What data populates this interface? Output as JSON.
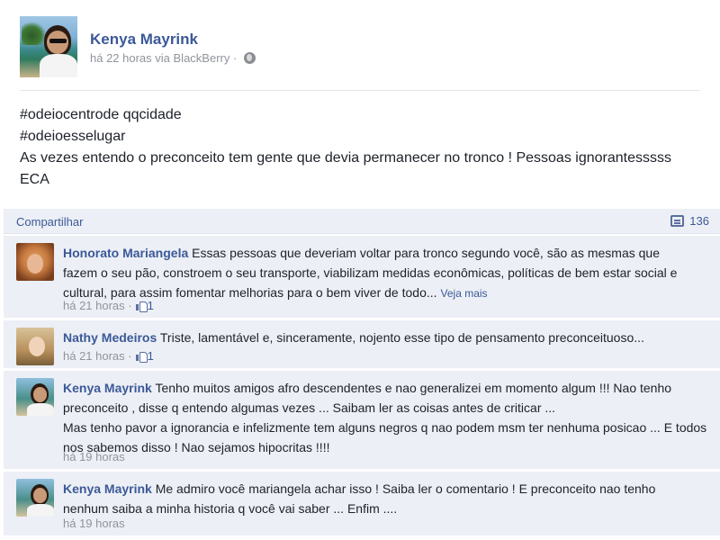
{
  "post": {
    "author": "Kenya Mayrink",
    "time": "há 22 horas via BlackBerry ·",
    "lines": [
      "#odeiocentrode qqcidade",
      "#odeioesselugar",
      "As vezes entendo o preconceito tem gente que devia permanecer no tronco ! Pessoas ignorantesssss",
      "ECA"
    ]
  },
  "actions": {
    "share_label": "Compartilhar",
    "comment_count": "136"
  },
  "comments": [
    {
      "author": "Honorato Mariangela",
      "line1": "Essas pessoas que deveriam voltar para tronco segundo você, são as mesmas que",
      "line2": "fazem o seu pão, constroem o seu transporte, viabilizam medidas econômicas, políticas de bem estar social e",
      "line3": "cultural, para assim fomentar melhorias para o bem viver de todo...",
      "see_more": "Veja mais",
      "time": "há 21 horas",
      "likes": "1"
    },
    {
      "author": "Nathy Medeiros",
      "line1": "Triste, lamentável e, sinceramente, nojento esse tipo de pensamento preconceituoso...",
      "time": "há 21 horas",
      "likes": "1"
    },
    {
      "author": "Kenya Mayrink",
      "line1": "Tenho muitos amigos afro descendentes e nao generalizei em momento algum !!! Nao tenho",
      "line2": "preconceito , disse q entendo algumas vezes ... Saibam ler as coisas antes de criticar ...",
      "line3": "Mas tenho pavor a ignorancia e infelizmente tem alguns negros q nao podem msm ter nenhuma posicao ... E todos",
      "line4": "nos sabemos disso ! Nao sejamos hipocritas !!!!",
      "time": "há 19 horas"
    },
    {
      "author": "Kenya Mayrink",
      "line1": "Me admiro você mariangela achar isso ! Saiba ler o comentario ! E preconceito nao tenho",
      "line2": "nenhum saiba a minha historia q você vai saber ... Enfim ....",
      "time": "há 19 horas"
    }
  ],
  "icons": {
    "privacy": "globe-icon",
    "comments": "comment-icon",
    "like": "like-icon"
  },
  "colors": {
    "link": "#3b5998",
    "meta": "#90949c",
    "comment_bg": "#eceff5"
  }
}
